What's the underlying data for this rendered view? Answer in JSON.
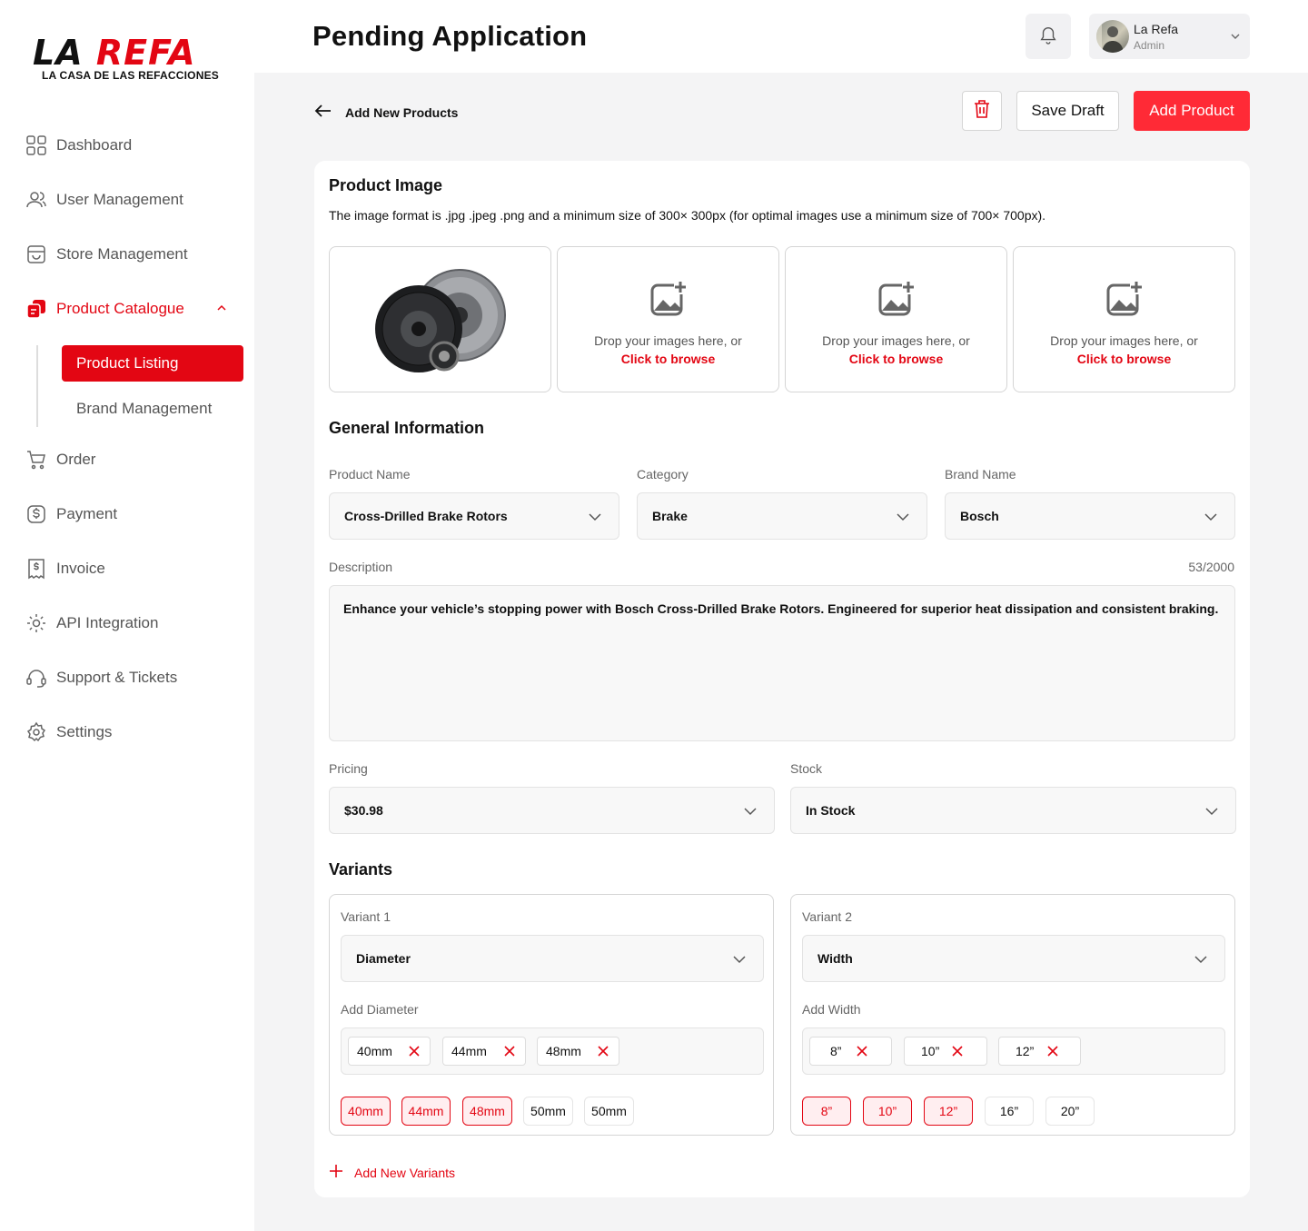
{
  "brand": {
    "logo_text_a": "LA ",
    "logo_text_b": "REFA",
    "logo_subtitle": "LA CASA DE LAS REFACCIONES"
  },
  "sidebar": {
    "items": [
      {
        "label": "Dashboard",
        "icon": "grid-icon"
      },
      {
        "label": "User Management",
        "icon": "users-icon"
      },
      {
        "label": "Store Management",
        "icon": "store-icon"
      },
      {
        "label": "Product Catalogue",
        "icon": "catalogue-icon",
        "active": true
      },
      {
        "label": "Order",
        "icon": "cart-icon"
      },
      {
        "label": "Payment",
        "icon": "dollar-icon"
      },
      {
        "label": "Invoice",
        "icon": "invoice-icon"
      },
      {
        "label": "API Integration",
        "icon": "api-gear-icon"
      },
      {
        "label": "Support & Tickets",
        "icon": "headset-icon"
      },
      {
        "label": "Settings",
        "icon": "settings-icon"
      }
    ],
    "subitems": [
      {
        "label": "Product Listing",
        "active": true
      },
      {
        "label": "Brand Management"
      }
    ]
  },
  "header": {
    "title": "Pending Application",
    "user": {
      "name": "La Refa",
      "role": "Admin"
    }
  },
  "toolbar": {
    "back_label": "Add New Products",
    "save_draft": "Save Draft",
    "add_product": "Add Product"
  },
  "product_image": {
    "title": "Product Image",
    "description": "The image format is .jpg .jpeg .png and a minimum size of 300× 300px (for optimal images use a minimum size of 700× 700px).",
    "drop_text": "Drop your images here, or",
    "browse_text": "Click to browse"
  },
  "general": {
    "title": "General Information",
    "product_name_label": "Product Name",
    "product_name": "Cross-Drilled Brake Rotors",
    "category_label": "Category",
    "category": "Brake",
    "brand_label": "Brand Name",
    "brand": "Bosch",
    "description_label": "Description",
    "description_counter": "53/2000",
    "description": "Enhance your vehicle’s stopping power with Bosch Cross-Drilled Brake Rotors. Engineered for superior heat dissipation and consistent braking.",
    "pricing_label": "Pricing",
    "pricing": "$30.98",
    "stock_label": "Stock",
    "stock": "In Stock"
  },
  "variants": {
    "title": "Variants",
    "v1": {
      "label": "Variant 1",
      "type": "Diameter",
      "add_label": "Add Diameter",
      "tags": [
        "40mm",
        "44mm",
        "48mm"
      ],
      "options": [
        {
          "label": "40mm",
          "selected": true
        },
        {
          "label": "44mm",
          "selected": true
        },
        {
          "label": "48mm",
          "selected": true
        },
        {
          "label": "50mm",
          "selected": false
        },
        {
          "label": "50mm",
          "selected": false
        }
      ]
    },
    "v2": {
      "label": "Variant 2",
      "type": "Width",
      "add_label": "Add Width",
      "tags": [
        "8”",
        "10”",
        "12”"
      ],
      "options": [
        {
          "label": "8”",
          "selected": true
        },
        {
          "label": "10”",
          "selected": true
        },
        {
          "label": "12”",
          "selected": true
        },
        {
          "label": "16”",
          "selected": false
        },
        {
          "label": "20”",
          "selected": false
        }
      ]
    },
    "add_new": "Add New Variants"
  },
  "colors": {
    "accent": "#e30613",
    "button_red": "#ff2a36"
  }
}
